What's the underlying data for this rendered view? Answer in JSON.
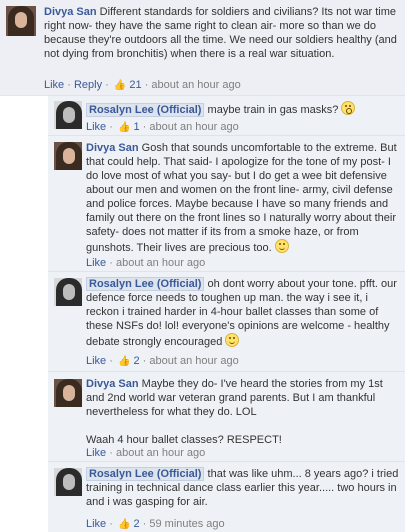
{
  "top": {
    "author": "Divya San",
    "text": "Different standards for soldiers and civilians? Its not war time right now- they have the same right to clean air- more so than we do because they're outdoors all the time. We need our soldiers healthy (and not dying from bronchitis) when there is a real war situation.",
    "like": "Like",
    "reply": "Reply",
    "likes_count": "21",
    "time": "about an hour ago"
  },
  "replies": [
    {
      "author": "Rosalyn Lee (Official)",
      "text": "maybe train in gas masks?",
      "emoticon": "surprised-face-icon",
      "like": "Like",
      "likes_count": "1",
      "time": "about an hour ago"
    },
    {
      "author": "Divya San",
      "text": "Gosh that sounds uncomfortable to the extreme. But that could help. That said- I apologize for the tone of my post- I do love most of what you say- but I do get a wee bit defensive about our men and women on the front line- army, civil defense and police forces. Maybe because I have so many friends and family out there on the front lines so I naturally worry about their safety- does not matter if its from a smoke haze, or from gunshots. Their lives are precious too.",
      "emoticon": "smile-icon",
      "like": "Like",
      "time": "about an hour ago"
    },
    {
      "author": "Rosalyn Lee (Official)",
      "text": "oh dont worry about your tone. pfft. our defence force needs to toughen up man. the way i see it, i reckon i trained harder in 4-hour ballet classes than some of these NSFs do! lol! everyone's opinions are welcome - healthy debate strongly encouraged",
      "emoticon": "smile-icon",
      "like": "Like",
      "likes_count": "2",
      "time": "about an hour ago"
    },
    {
      "author": "Divya San",
      "text": "Maybe they do- I've heard the stories from my 1st and 2nd world war veteran grand parents. But I am thankful nevertheless for what they do. LOL",
      "text2": "Waah 4 hour ballet classes? RESPECT!",
      "like": "Like",
      "time": "about an hour ago"
    },
    {
      "author": "Rosalyn Lee (Official)",
      "text": "that was like uhm... 8 years ago? i tried training in technical dance class earlier this year..... two hours in and i was gasping for air.",
      "like": "Like",
      "likes_count": "2",
      "time": "59 minutes ago"
    }
  ]
}
